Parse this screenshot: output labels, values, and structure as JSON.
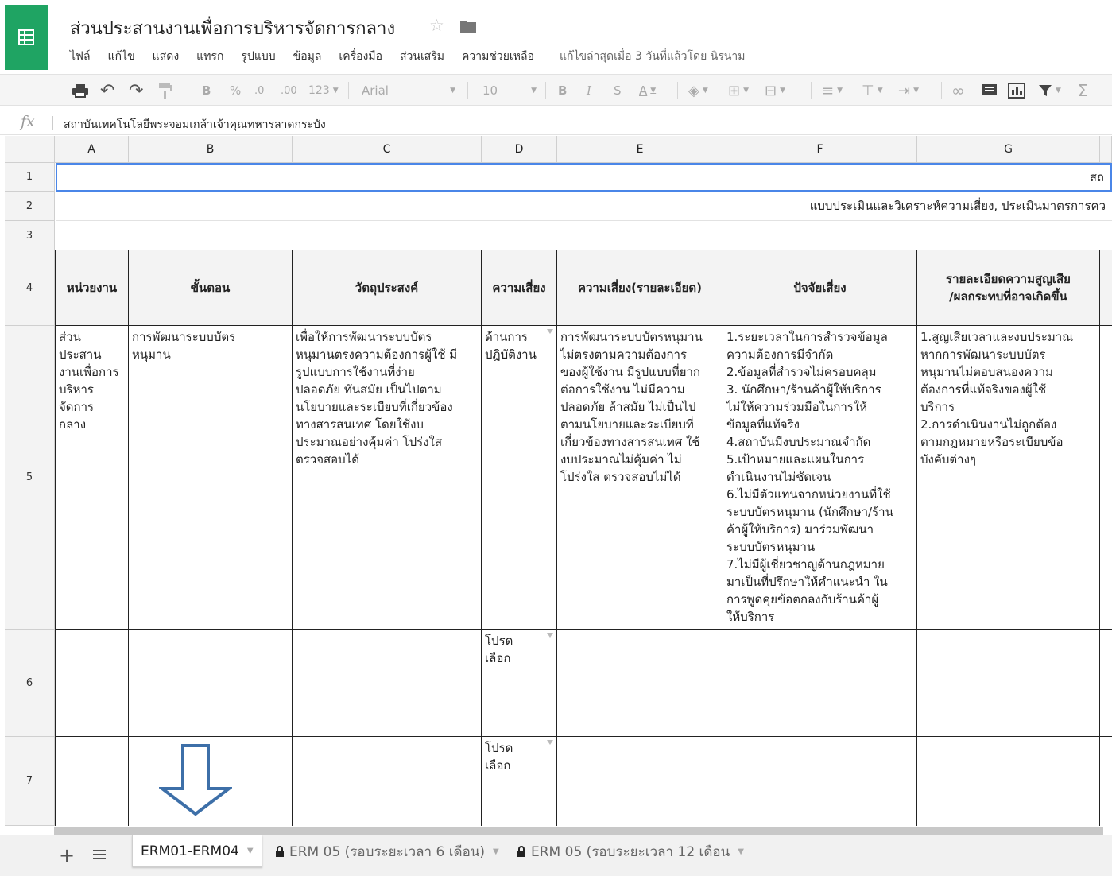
{
  "doc": {
    "title": "ส่วนประสานงานเพื่อการบริหารจัดการกลาง"
  },
  "menu": [
    "ไฟล์",
    "แก้ไข",
    "แสดง",
    "แทรก",
    "รูปแบบ",
    "ข้อมูล",
    "เครื่องมือ",
    "ส่วนเสริม",
    "ความช่วยเหลือ"
  ],
  "last_edit": "แก้ไขล่าสุดเมื่อ 3 วันที่แล้วโดย นิรนาม",
  "toolbar": {
    "currency": "B",
    "percent": "%",
    "dec_less": ".0",
    "dec_more": ".00",
    "more_formats": "123",
    "font": "Arial",
    "font_size": "10",
    "bold": "B",
    "italic": "I",
    "strike": "S",
    "text_color": "A",
    "accent": "#f5f5f5"
  },
  "formula": {
    "value": "สถาบันเทคโนโลยีพระจอมเกล้าเจ้าคุณทหารลาดกระบัง"
  },
  "columns": [
    "A",
    "B",
    "C",
    "D",
    "E",
    "F",
    "G"
  ],
  "rows": [
    "1",
    "2",
    "3",
    "4",
    "5",
    "6",
    "7"
  ],
  "row1_text": "สถ",
  "row2_text": "แบบประเมินและวิเคราะห์ความเสี่ยง, ประเมินมาตรการคว",
  "headers": [
    "หน่วยงาน",
    "ขั้นตอน",
    "วัตถุประสงค์",
    "ความเสี่ยง",
    "ความเสี่ยง(รายละเอียด)",
    "ปัจจัยเสี่ยง",
    "รายละเอียดความสูญเสีย\n/ผลกระทบที่อาจเกิดขึ้น"
  ],
  "row5": {
    "a": "ส่วน\nประสาน\nงานเพื่อการ\nบริหาร\nจัดการ\nกลาง",
    "b": "การพัฒนาระบบบัตร\nหนุมาน",
    "c": "เพื่อให้การพัฒนาระบบบัตร\nหนุมานตรงความต้องการผู้ใช้ มี\nรูปแบบการใช้งานที่ง่าย\nปลอดภัย ทันสมัย เป็นไปตาม\nนโยบายและระเบียบที่เกี่ยวข้อง\nทางสารสนเทศ โดยใช้งบ\nประมาณอย่างคุ้มค่า โปร่งใส\nตรวจสอบได้",
    "d": "ด้านการ\nปฏิบัติงาน",
    "e": "การพัฒนาระบบบัตรหนุมาน\nไม่ตรงตามความต้องการ\nของผู้ใช้งาน มีรูปแบบที่ยาก\nต่อการใช้งาน ไม่มีความ\nปลอดภัย ล้าสมัย ไม่เป็นไป\nตามนโยบายและระเบียบที่\nเกี่ยวข้องทางสารสนเทศ ใช้\nงบประมาณไม่คุ้มค่า ไม่\nโปร่งใส ตรวจสอบไม่ได้",
    "f": "1.ระยะเวลาในการสำรวจข้อมูล\nความต้องการมีจำกัด\n2.ข้อมูลที่สำรวจไม่ครอบคลุม\n3. นักศึกษา/ร้านค้าผู้ให้บริการ\nไม่ให้ความร่วมมือในการให้\nข้อมูลที่แท้จริง\n4.สถาบันมีงบประมาณจำกัด\n5.เป้าหมายและแผนในการ\nดำเนินงานไม่ชัดเจน\n6.ไม่มีตัวแทนจากหน่วยงานที่ใช้\nระบบบัตรหนุมาน (นักศึกษา/ร้าน\nค้าผู้ให้บริการ) มาร่วมพัฒนา\nระบบบัตรหนุมาน\n7.ไม่มีผู้เชี่ยวชาญด้านกฎหมาย\nมาเป็นที่ปรึกษาให้คำแนะนำ ใน\nการพูดคุยข้อตกลงกับร้านค้าผู้\nให้บริการ",
    "g": "1.สูญเสียเวลาและงบประมาณ\nหากการพัฒนาระบบบัตร\nหนุมานไม่ตอบสนองความ\nต้องการที่แท้จริงของผู้ใช้\nบริการ\n2.การดำเนินงานไม่ถูกต้อง\nตามกฎหมายหรือระเบียบข้อ\nบังคับต่างๆ"
  },
  "row6_d": "โปรด\nเลือก",
  "row7_d": "โปรด\nเลือก",
  "sheets": [
    {
      "label": "ERM01-ERM04",
      "locked": false,
      "active": true
    },
    {
      "label": "ERM 05 (รอบระยะเวลา 6 เดือน)",
      "locked": true,
      "active": false
    },
    {
      "label": "ERM 05 (รอบระยะเวลา 12 เดือน",
      "locked": true,
      "active": false
    }
  ],
  "colors": {
    "brand": "#1fa463",
    "selection": "#4a86e8",
    "arrow": "#3d6fa8"
  }
}
